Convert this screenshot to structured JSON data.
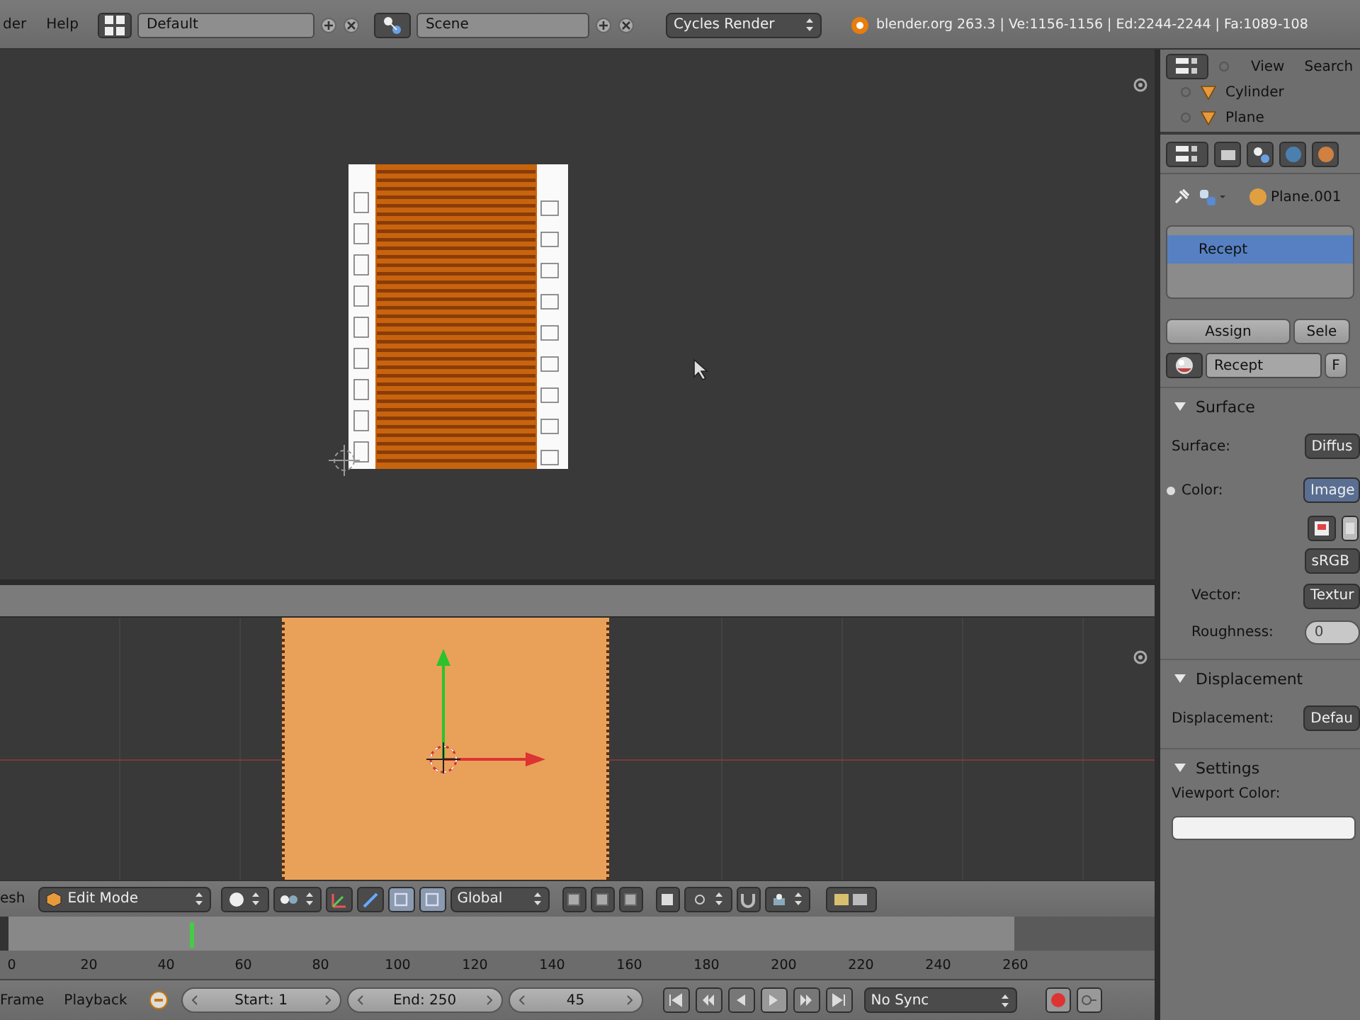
{
  "top_bar": {
    "menus": [
      "der",
      "Help"
    ],
    "screen_layout": "Default",
    "scene": "Scene",
    "render_engine": "Cycles Render",
    "stats": "blender.org 263.3 | Ve:1156-1156 | Ed:2244-2244 | Fa:1089-108"
  },
  "view_header": {
    "menu": "esh",
    "mode": "Edit Mode",
    "orientation": "Global"
  },
  "timeline": {
    "ticks": [
      "0",
      "20",
      "40",
      "60",
      "80",
      "100",
      "120",
      "140",
      "160",
      "180",
      "200",
      "220",
      "240",
      "260"
    ],
    "playhead": {
      "level": 0.165
    }
  },
  "playback_bar": {
    "menus": [
      "Frame",
      "Playback"
    ],
    "start": "Start: 1",
    "end": "End: 250",
    "current_frame": "45",
    "sync": "No Sync"
  },
  "outliner": {
    "menus": [
      "View",
      "Search"
    ],
    "items": [
      {
        "name": "Cylinder"
      },
      {
        "name": "Plane"
      }
    ]
  },
  "properties": {
    "object": "Plane.001",
    "material_slots": [
      {
        "name": "Recept",
        "selected": true
      }
    ],
    "slot_buttons": [
      "Assign",
      "Sele"
    ],
    "material": "Recept",
    "fake_user": "F",
    "panels": [
      {
        "title": "Surface",
        "expanded": true,
        "rows": [
          {
            "kind": "field",
            "label": "Surface:",
            "value": "Diffus"
          },
          {
            "kind": "socket",
            "label": "Color:",
            "value": "Image"
          },
          {
            "kind": "icons"
          },
          {
            "kind": "value",
            "value": "sRGB"
          },
          {
            "kind": "input",
            "label": "Vector:",
            "value": "Textur"
          },
          {
            "kind": "slider",
            "label": "Roughness:",
            "value": "0"
          }
        ]
      },
      {
        "title": "Displacement",
        "expanded": true,
        "rows": [
          {
            "kind": "field",
            "label": "Displacement:",
            "value": "Defau"
          }
        ]
      },
      {
        "title": "Settings",
        "expanded": true,
        "rows": [
          {
            "kind": "color",
            "label": "Viewport Color:"
          }
        ]
      }
    ]
  }
}
